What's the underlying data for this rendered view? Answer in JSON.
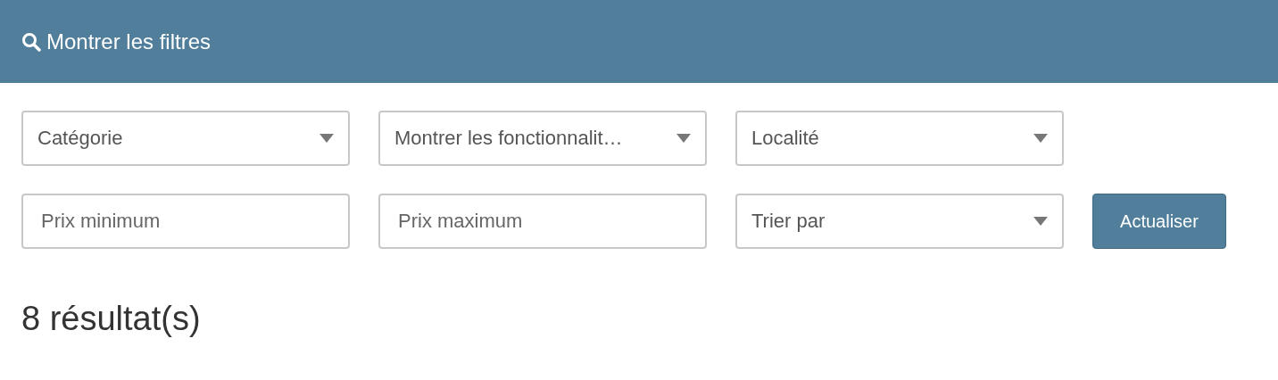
{
  "header": {
    "title": "Montrer les filtres"
  },
  "filter_rows": [
    [
      {
        "kind": "select",
        "value": "Catégorie"
      },
      {
        "kind": "select",
        "value": "Montrer les fonctionnalit…"
      },
      {
        "kind": "select",
        "value": "Localité"
      }
    ],
    [
      {
        "kind": "input",
        "placeholder": "Prix minimum"
      },
      {
        "kind": "input",
        "placeholder": "Prix maximum"
      },
      {
        "kind": "select",
        "value": "Trier par"
      },
      {
        "kind": "button",
        "label": "Actualiser"
      }
    ]
  ],
  "results": {
    "count": "8 résultat(s)"
  }
}
